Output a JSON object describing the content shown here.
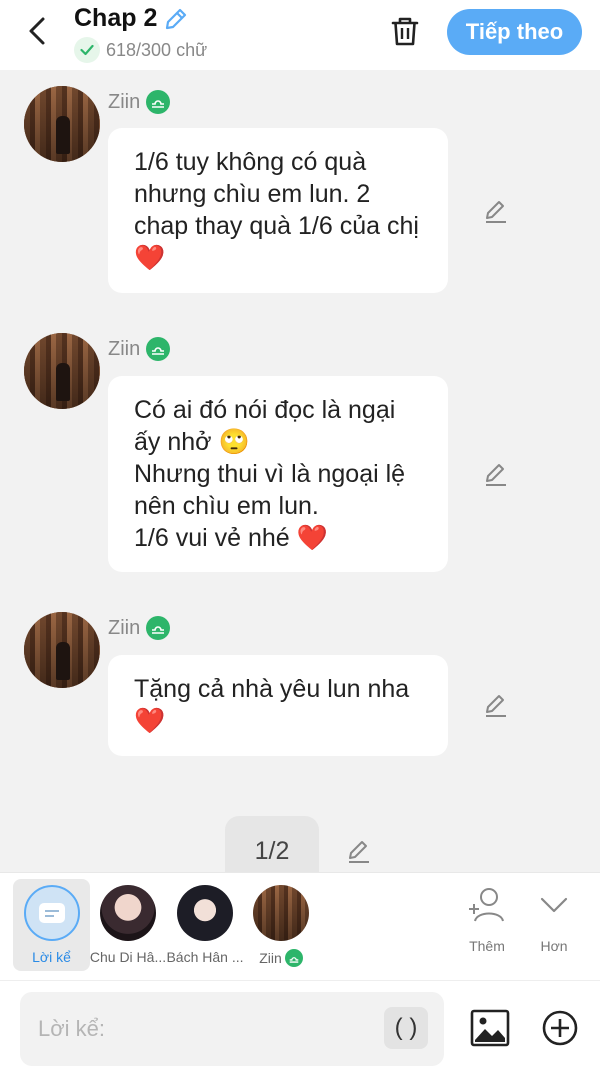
{
  "header": {
    "title": "Chap 2",
    "word_count": "618/300 chữ",
    "next_label": "Tiếp theo",
    "next_color": "#5aabf6"
  },
  "messages": [
    {
      "sender": "Ziin",
      "text": "1/6 tuy không có quà nhưng chìu em lun. 2 chap thay quà 1/6 của chị ❤️"
    },
    {
      "sender": "Ziin",
      "text": "Có ai đó nói đọc là ngại ấy nhở 🙄\nNhưng thui vì là ngoại lệ nên chìu em lun.\n1/6 vui vẻ nhé ❤️"
    },
    {
      "sender": "Ziin",
      "text": "Tặng cả nhà yêu lun nha ❤️"
    }
  ],
  "pagination": {
    "label": "1/2"
  },
  "characters": [
    {
      "name": "Lời kể",
      "icon": "narrator-icon"
    },
    {
      "name": "Chu Di Hâ..."
    },
    {
      "name": "Bách Hân ..."
    },
    {
      "name": "Ziin",
      "icon": "libra-icon"
    }
  ],
  "tools": {
    "add_label": "Thêm",
    "more_label": "Hơn"
  },
  "input": {
    "placeholder": "Lời kể:",
    "paren_label": "( )"
  }
}
